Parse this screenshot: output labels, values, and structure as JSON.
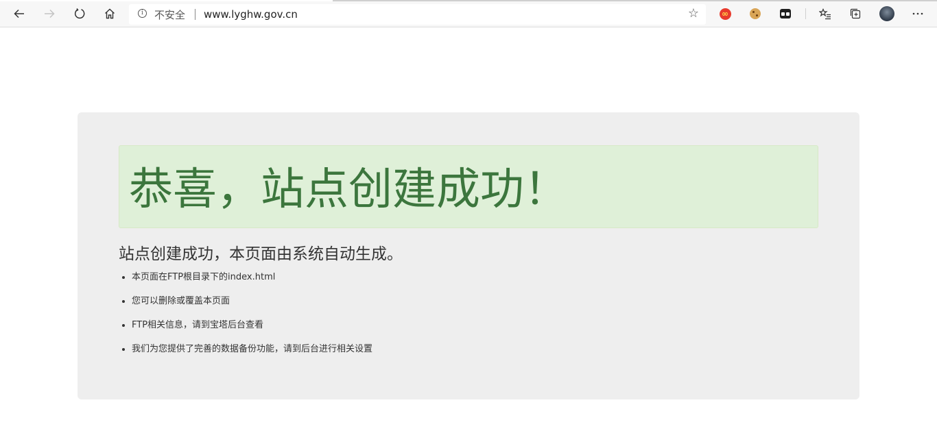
{
  "browser": {
    "security_label": "不安全",
    "url": "www.lyghw.gov.cn"
  },
  "page": {
    "headline": "恭喜，站点创建成功！",
    "subtitle": "站点创建成功，本页面由系统自动生成。",
    "items": [
      {
        "text": "本页面在FTP根目录下的index.html"
      },
      {
        "text": "您可以删除或覆盖本页面"
      },
      {
        "text": "FTP相关信息，请到宝塔后台查看"
      },
      {
        "text": "我们为您提供了完善的数据备份功能，请到后台进行相关设置"
      }
    ]
  },
  "colors": {
    "success_background": "#dff0d8",
    "success_text": "#3c763d",
    "panel_background": "#eeeeee"
  },
  "icons": {
    "back": "arrow-left-icon",
    "forward": "arrow-right-icon",
    "refresh": "refresh-icon",
    "home": "home-icon",
    "info": "info-icon",
    "favorite": "star-icon",
    "favorites_bar": "favorites-icon",
    "collections": "collections-icon",
    "menu": "more-icon"
  }
}
